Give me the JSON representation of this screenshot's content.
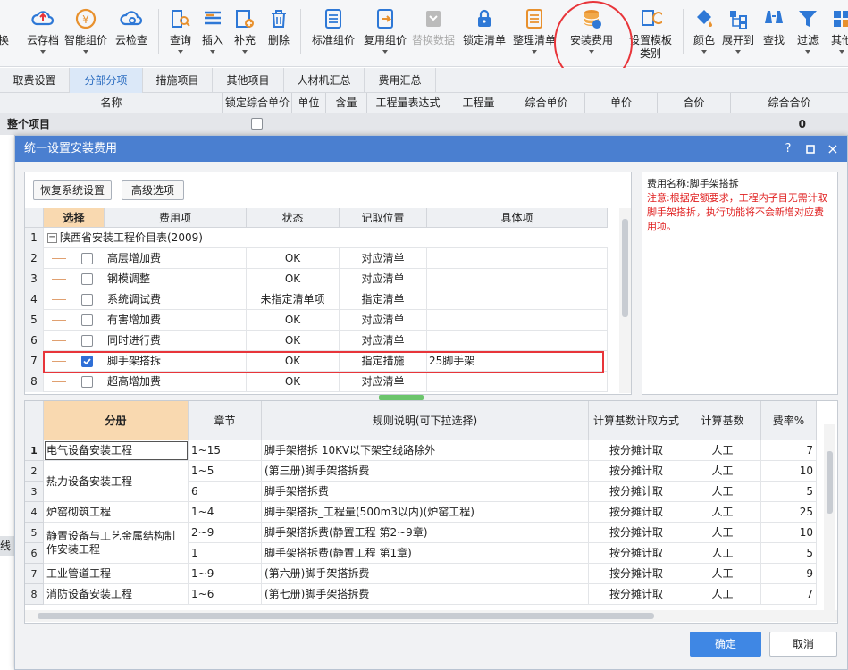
{
  "toolbar": {
    "items": [
      {
        "label": "换",
        "icon": "replace-icon"
      },
      {
        "label": "云存档",
        "icon": "cloud-save-icon"
      },
      {
        "label": "智能组价",
        "icon": "smart-price-icon"
      },
      {
        "label": "云检查",
        "icon": "cloud-check-icon"
      },
      {
        "label": "查询",
        "icon": "query-icon"
      },
      {
        "label": "插入",
        "icon": "insert-icon"
      },
      {
        "label": "补充",
        "icon": "supplement-icon"
      },
      {
        "label": "删除",
        "icon": "delete-icon"
      },
      {
        "label": "标准组价",
        "icon": "standard-price-icon"
      },
      {
        "label": "复用组价",
        "icon": "reuse-price-icon"
      },
      {
        "label": "替换数据",
        "icon": "replace-data-icon"
      },
      {
        "label": "锁定清单",
        "icon": "lock-icon"
      },
      {
        "label": "整理清单",
        "icon": "organize-list-icon"
      },
      {
        "label": "安装费用",
        "icon": "install-fee-icon"
      },
      {
        "label": "设置模板",
        "label2": "类别",
        "icon": "template-icon"
      },
      {
        "label": "颜色",
        "icon": "color-icon"
      },
      {
        "label": "展开到",
        "icon": "expand-icon"
      },
      {
        "label": "查找",
        "icon": "find-icon"
      },
      {
        "label": "过滤",
        "icon": "filter-icon"
      },
      {
        "label": "其他",
        "icon": "more-icon"
      }
    ]
  },
  "tabs": [
    "取费设置",
    "分部分项",
    "措施项目",
    "其他项目",
    "人材机汇总",
    "费用汇总"
  ],
  "main_header": [
    "名称",
    "锁定综合单价",
    "单位",
    "含量",
    "工程量表达式",
    "工程量",
    "综合单价",
    "单价",
    "合价",
    "综合合价"
  ],
  "main_row": {
    "name": "整个项目",
    "total": "0"
  },
  "side_text": "线",
  "dialog": {
    "title": "统一设置安装费用",
    "restore_btn": "恢复系统设置",
    "advanced_btn": "高级选项",
    "fee_header": [
      "选择",
      "费用项",
      "状态",
      "记取位置",
      "具体项"
    ],
    "root_label": "陕西省安装工程价目表(2009)",
    "fee_rows": [
      {
        "no": "2",
        "checked": false,
        "item": "高层增加费",
        "status": "OK",
        "pos": "对应清单",
        "detail": ""
      },
      {
        "no": "3",
        "checked": false,
        "item": "钢模调整",
        "status": "OK",
        "pos": "对应清单",
        "detail": ""
      },
      {
        "no": "4",
        "checked": false,
        "item": "系统调试费",
        "status": "未指定清单项",
        "pos": "指定清单",
        "detail": ""
      },
      {
        "no": "5",
        "checked": false,
        "item": "有害增加费",
        "status": "OK",
        "pos": "对应清单",
        "detail": ""
      },
      {
        "no": "6",
        "checked": false,
        "item": "同时进行费",
        "status": "OK",
        "pos": "对应清单",
        "detail": ""
      },
      {
        "no": "7",
        "checked": true,
        "item": "脚手架搭拆",
        "status": "OK",
        "pos": "指定措施",
        "detail": "25脚手架"
      },
      {
        "no": "8",
        "checked": false,
        "item": "超高增加费",
        "status": "OK",
        "pos": "对应清单",
        "detail": ""
      }
    ],
    "info_name": "费用名称:脚手架搭拆",
    "info_note": "注意:根据定额要求，工程内子目无需计取脚手架搭拆，执行功能将不会新增对应费用项。",
    "rule_header": [
      "分册",
      "章节",
      "规则说明(可下拉选择)",
      "计算基数计取方式",
      "计算基数",
      "费率%"
    ],
    "rule_rows": [
      {
        "no": "1",
        "book": "电气设备安装工程",
        "chapter": "1~15",
        "rule": "脚手架搭拆 10KV以下架空线路除外",
        "mode": "按分摊计取",
        "base": "人工",
        "rate": "7"
      },
      {
        "no": "2",
        "book": "热力设备安装工程",
        "chapter": "1~5",
        "rule": "(第三册)脚手架搭拆费",
        "mode": "按分摊计取",
        "base": "人工",
        "rate": "10"
      },
      {
        "no": "3",
        "book": "",
        "chapter": "6",
        "rule": "脚手架搭拆费",
        "mode": "按分摊计取",
        "base": "人工",
        "rate": "5"
      },
      {
        "no": "4",
        "book": "炉窑砌筑工程",
        "chapter": "1~4",
        "rule": "脚手架搭拆_工程量(500m3以内)(炉窑工程)",
        "mode": "按分摊计取",
        "base": "人工",
        "rate": "25"
      },
      {
        "no": "5",
        "book": "静置设备与工艺金属结构制作安装工程",
        "chapter": "2~9",
        "rule": "脚手架搭拆费(静置工程 第2~9章)",
        "mode": "按分摊计取",
        "base": "人工",
        "rate": "10"
      },
      {
        "no": "6",
        "book": "",
        "chapter": "1",
        "rule": "脚手架搭拆费(静置工程 第1章)",
        "mode": "按分摊计取",
        "base": "人工",
        "rate": "5"
      },
      {
        "no": "7",
        "book": "工业管道工程",
        "chapter": "1~9",
        "rule": "(第六册)脚手架搭拆费",
        "mode": "按分摊计取",
        "base": "人工",
        "rate": "9"
      },
      {
        "no": "8",
        "book": "消防设备安装工程",
        "chapter": "1~6",
        "rule": "(第七册)脚手架搭拆费",
        "mode": "按分摊计取",
        "base": "人工",
        "rate": "7"
      }
    ],
    "ok_btn": "确定",
    "cancel_btn": "取消"
  },
  "colors": {
    "accent": "#4a7fd0",
    "highlight": "#e8353a",
    "selected_header": "#f9d9b0"
  }
}
